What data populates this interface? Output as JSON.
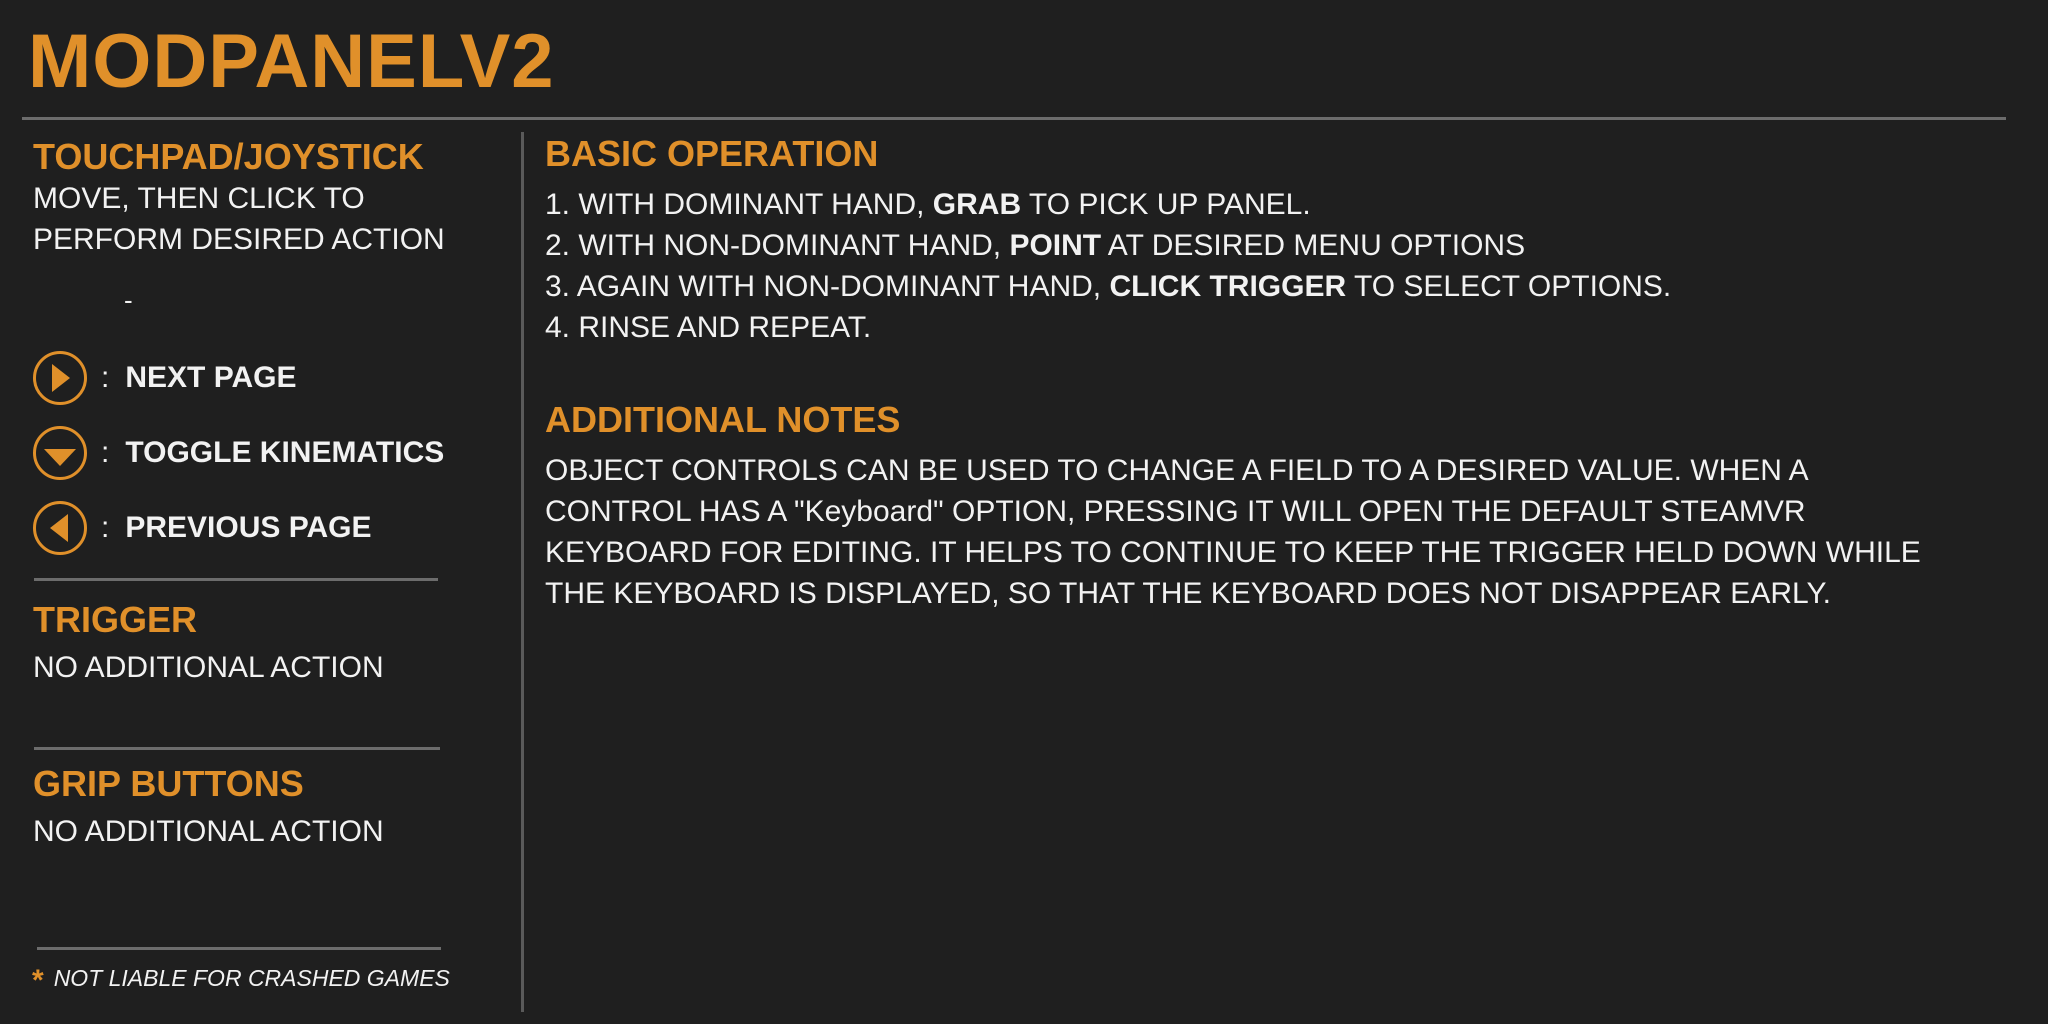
{
  "header": {
    "title": "MODPANELV2"
  },
  "sidebar": {
    "touchpad": {
      "heading": "TOUCHPAD/JOYSTICK",
      "line1": "MOVE, THEN CLICK TO",
      "line2": "PERFORM DESIRED ACTION",
      "dash": "-"
    },
    "controls": [
      {
        "icon": "arrow-right-icon",
        "colon": ":",
        "label": "NEXT PAGE"
      },
      {
        "icon": "arrow-down-icon",
        "colon": ":",
        "label": "TOGGLE KINEMATICS"
      },
      {
        "icon": "arrow-left-icon",
        "colon": ":",
        "label": "PREVIOUS PAGE"
      }
    ],
    "trigger": {
      "heading": "TRIGGER",
      "text": "NO ADDITIONAL ACTION"
    },
    "grip": {
      "heading": "GRIP BUTTONS",
      "text": "NO ADDITIONAL ACTION"
    },
    "footnote": {
      "star": "*",
      "text": "NOT LIABLE FOR CRASHED GAMES"
    }
  },
  "main": {
    "basic": {
      "heading": "BASIC OPERATION",
      "steps": [
        {
          "pre": "1. WITH DOMINANT HAND, ",
          "bold": "GRAB",
          "post": " TO PICK UP PANEL."
        },
        {
          "pre": "2. WITH NON-DOMINANT HAND, ",
          "bold": "POINT",
          "post": " AT DESIRED MENU OPTIONS"
        },
        {
          "pre": "3. AGAIN WITH NON-DOMINANT HAND, ",
          "bold": "CLICK TRIGGER",
          "post": " TO SELECT OPTIONS."
        },
        {
          "pre": "4. RINSE AND REPEAT.",
          "bold": "",
          "post": ""
        }
      ]
    },
    "notes": {
      "heading": "ADDITIONAL NOTES",
      "lines": [
        "OBJECT CONTROLS CAN BE USED TO CHANGE A FIELD TO A DESIRED VALUE. WHEN A",
        "CONTROL HAS A \"Keyboard\" OPTION, PRESSING IT WILL OPEN THE DEFAULT STEAMVR",
        "KEYBOARD FOR EDITING. IT HELPS TO CONTINUE TO KEEP THE TRIGGER HELD DOWN WHILE",
        "THE KEYBOARD IS DISPLAYED, SO THAT THE KEYBOARD DOES NOT DISAPPEAR EARLY."
      ]
    }
  },
  "colors": {
    "accent": "#e0902a",
    "background": "#1f1f1f",
    "text": "#f2f2f2",
    "rule": "#6c6c6c"
  }
}
